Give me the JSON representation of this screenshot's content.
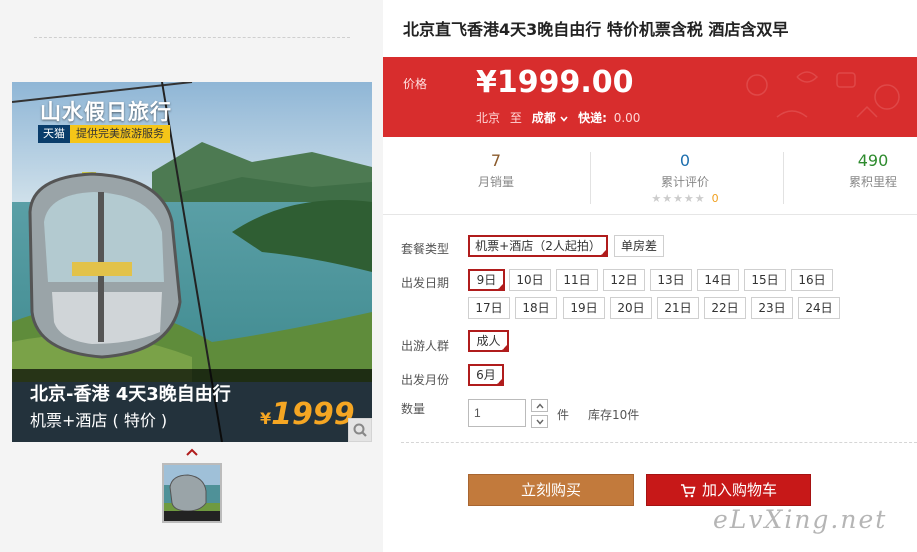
{
  "gallery": {
    "brand_title": "山水假日旅行",
    "brand_tmall": "天猫",
    "brand_service": "提供完美旅游服务",
    "caption_line1": "北京-香港 4天3晚自由行",
    "caption_line2": "机票+酒店 ( 特价 )",
    "caption_currency": "¥",
    "caption_price": "1999",
    "zoom_icon": "magnifier-icon",
    "thumb_arrow_icon": "chevron-up-icon"
  },
  "product": {
    "title": "北京直飞香港4天3晚自由行 特价机票含税 酒店含双早"
  },
  "price": {
    "label": "价格",
    "value": "¥1999.00",
    "from_city": "北京",
    "to_word": "至",
    "to_city": "成都",
    "shipping_label": "快递:",
    "shipping_value": "0.00"
  },
  "stats": {
    "monthly_sales_value": "7",
    "monthly_sales_label": "月销量",
    "reviews_value": "0",
    "reviews_label": "累计评价",
    "stars_text": "★★★★★",
    "stars_count": "0",
    "points_value": "490",
    "points_label": "累积里程"
  },
  "options": {
    "package_label": "套餐类型",
    "packages": [
      "机票+酒店（2人起拍）",
      "单房差"
    ],
    "date_label": "出发日期",
    "dates": [
      "9日",
      "10日",
      "11日",
      "12日",
      "13日",
      "14日",
      "15日",
      "16日",
      "17日",
      "18日",
      "19日",
      "20日",
      "21日",
      "22日",
      "23日",
      "24日"
    ],
    "crowd_label": "出游人群",
    "crowd": [
      "成人"
    ],
    "month_label": "出发月份",
    "months": [
      "6月"
    ],
    "qty_label": "数量",
    "qty_value": "1",
    "qty_unit": "件",
    "stock": "库存10件"
  },
  "actions": {
    "buy_now": "立刻购买",
    "add_to_cart": "加入购物车"
  },
  "watermark": "eLvXing.net",
  "colors": {
    "price_band": "#d82d2d",
    "selected_border": "#b01c1c",
    "buy_button": "#c27a3c",
    "cart_button": "#c71818",
    "points_green": "#2e8b2e",
    "stat_blue": "#1e6fae",
    "stat_brown": "#8a5a2b"
  }
}
